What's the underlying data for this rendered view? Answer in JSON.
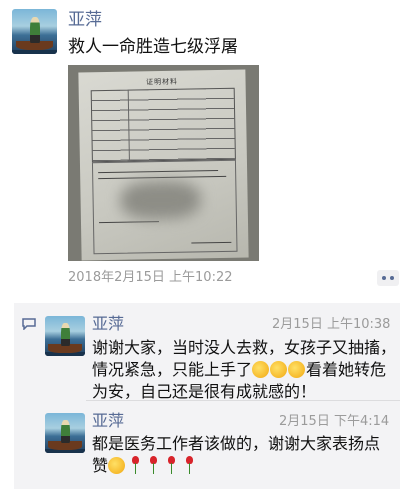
{
  "post": {
    "author": "亚萍",
    "text": "救人一命胜造七级浮屠",
    "image_title": "证明材料",
    "timestamp": "2018年2月15日 上午10:22"
  },
  "comments": [
    {
      "author": "亚萍",
      "time": "2月15日 上午10:38",
      "text_1": "谢谢大家，当时没人去救，女孩子又抽搐，",
      "text_2a": "情况紧急，只能上手了",
      "text_2b": "看着她转危",
      "text_3": "为安，自己还是很有成就感的！",
      "emojis": [
        "facepalm-emoji",
        "facepalm-emoji",
        "facepalm-emoji"
      ]
    },
    {
      "author": "亚萍",
      "time": "2月15日 下午4:14",
      "text_1": "都是医务工作者该做的，谢谢大家表扬点",
      "text_2": "赞",
      "emojis": [
        "smile-emoji",
        "rose-emoji",
        "rose-emoji",
        "rose-emoji",
        "rose-emoji"
      ]
    }
  ],
  "colors": {
    "name_link": "#576b95",
    "timestamp": "#9b9b9b",
    "comment_bg": "#f3f3f5"
  }
}
